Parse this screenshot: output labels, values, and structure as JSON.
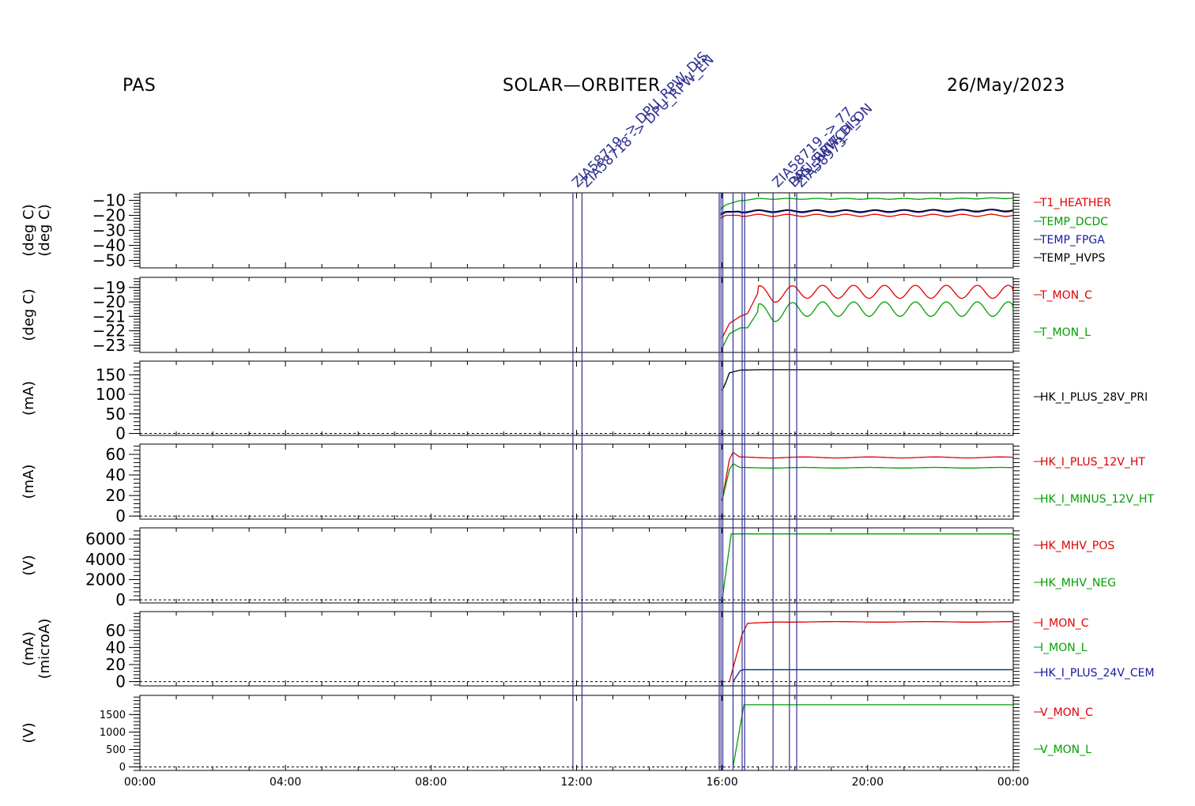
{
  "header": {
    "left": "PAS",
    "center": "SOLAR—ORBITER",
    "right": "26/May/2023"
  },
  "colors": {
    "red": "#e00000",
    "green": "#00a000",
    "blue": "#1a1aa0",
    "black": "#000000",
    "event": "#303090"
  },
  "chart_data": {
    "type": "line",
    "x_axis": {
      "range_hours": [
        0,
        24
      ],
      "tick_labels": [
        "00:00",
        "04:00",
        "08:00",
        "12:00",
        "16:00",
        "20:00",
        "00:00"
      ],
      "tick_hours": [
        0,
        4,
        8,
        12,
        16,
        20,
        24
      ]
    },
    "events": {
      "lines_hours": [
        11.9,
        12.15,
        15.92,
        15.97,
        16.02,
        16.3,
        16.55,
        16.62,
        17.4,
        17.85,
        18.05
      ],
      "labels": [
        {
          "text": "ZIA58719 -> DPU_RPW_DIS",
          "hour": 11.9
        },
        {
          "text": "ZIA58718 -> DPU_RPW_EN",
          "hour": 12.15
        },
        {
          "text": "ZIA58719 -> 77",
          "hour": 17.4
        },
        {
          "text": "DPU_RPW_DIS",
          "hour": 17.85
        },
        {
          "text": "PAS_SWITCH_ON",
          "hour": 17.85
        },
        {
          "text": "ZIA58973",
          "hour": 18.05
        }
      ]
    },
    "panels": [
      {
        "id": "temps",
        "ylabel": "(deg C)",
        "ylabel2": "(deg C)",
        "ylim": [
          -55,
          -5
        ],
        "yticks": [
          -10,
          -20,
          -30,
          -40,
          -50
        ],
        "ytick_labels": [
          "−10",
          "−20",
          "−30",
          "−40",
          "−50"
        ],
        "series": [
          {
            "name": "T1_HEATHER",
            "color": "red",
            "points": [
              [
                15.95,
                -22
              ],
              [
                16.1,
                -20
              ],
              [
                17,
                -20
              ],
              [
                18,
                -20
              ],
              [
                19,
                -20
              ],
              [
                20,
                -20
              ],
              [
                21,
                -20
              ],
              [
                22,
                -20
              ],
              [
                23,
                -20
              ],
              [
                24,
                -20
              ]
            ],
            "osc": [
              0.7,
              0.8
            ]
          },
          {
            "name": "TEMP_DCDC",
            "color": "green",
            "points": [
              [
                15.95,
                -16
              ],
              [
                16.1,
                -13
              ],
              [
                16.5,
                -10
              ],
              [
                17,
                -9
              ],
              [
                18,
                -9
              ],
              [
                20,
                -9
              ],
              [
                22,
                -9
              ],
              [
                24,
                -8.5
              ]
            ],
            "osc": [
              0.3,
              0.8
            ]
          },
          {
            "name": "TEMP_FPGA",
            "color": "blue",
            "points": [
              [
                15.95,
                -20
              ],
              [
                16.1,
                -18
              ],
              [
                17,
                -17.5
              ],
              [
                20,
                -17.5
              ],
              [
                24,
                -17
              ]
            ],
            "osc": [
              0.7,
              0.8
            ]
          },
          {
            "name": "TEMP_HVPS",
            "color": "black",
            "points": [
              [
                15.95,
                -19
              ],
              [
                16.1,
                -17.5
              ],
              [
                17,
                -17
              ],
              [
                20,
                -17
              ],
              [
                24,
                -16.5
              ]
            ],
            "osc": [
              0.6,
              0.8
            ]
          }
        ]
      },
      {
        "id": "tmon",
        "ylabel": "(deg C)",
        "ylabel2": "",
        "ylim": [
          -23.5,
          -18.3
        ],
        "yticks": [
          -19,
          -20,
          -21,
          -22,
          -23
        ],
        "ytick_labels": [
          "−19",
          "−20",
          "−21",
          "−22",
          "−23"
        ],
        "series": [
          {
            "name": "T_MON_C",
            "color": "red",
            "points": [
              [
                16.0,
                -22.5
              ],
              [
                16.2,
                -21.5
              ],
              [
                16.5,
                -21
              ],
              [
                16.7,
                -20.8
              ],
              [
                17.0,
                -19.3
              ],
              [
                17.4,
                -19.6
              ],
              [
                18,
                -19.3
              ],
              [
                24,
                -19.3
              ]
            ],
            "osc_after": 17.0,
            "osc": [
              0.45,
              0.85
            ]
          },
          {
            "name": "T_MON_L",
            "color": "green",
            "points": [
              [
                16.0,
                -23.2
              ],
              [
                16.2,
                -22.2
              ],
              [
                16.5,
                -21.8
              ],
              [
                16.7,
                -21.8
              ],
              [
                17.0,
                -20.6
              ],
              [
                17.4,
                -20.9
              ],
              [
                18,
                -20.5
              ],
              [
                24,
                -20.5
              ]
            ],
            "osc_after": 17.0,
            "osc": [
              0.5,
              0.85
            ]
          }
        ]
      },
      {
        "id": "i28",
        "ylabel": "(mA)",
        "ylabel2": "",
        "ylim": [
          -5,
          185
        ],
        "yticks": [
          150,
          100,
          50,
          0
        ],
        "ytick_labels": [
          "150",
          "100",
          "50",
          "0"
        ],
        "zero_line": true,
        "series": [
          {
            "name": "HK_I_PLUS_28V_PRI",
            "color": "black",
            "points": [
              [
                16.0,
                110
              ],
              [
                16.1,
                130
              ],
              [
                16.2,
                155
              ],
              [
                16.5,
                162
              ],
              [
                17,
                163
              ],
              [
                24,
                163
              ]
            ]
          }
        ]
      },
      {
        "id": "i12",
        "ylabel": "(mA)",
        "ylabel2": "",
        "ylim": [
          -3,
          70
        ],
        "yticks": [
          60,
          40,
          20,
          0
        ],
        "ytick_labels": [
          "60",
          "40",
          "20",
          "0"
        ],
        "zero_line": true,
        "series": [
          {
            "name": "HK_I_PLUS_12V_HT",
            "color": "red",
            "points": [
              [
                16.0,
                15
              ],
              [
                16.2,
                55
              ],
              [
                16.3,
                62
              ],
              [
                16.5,
                57
              ],
              [
                24,
                57
              ]
            ],
            "osc": [
              0.5,
              1.8
            ]
          },
          {
            "name": "HK_I_MINUS_12V_HT",
            "color": "green",
            "points": [
              [
                16.0,
                15
              ],
              [
                16.2,
                45
              ],
              [
                16.3,
                51
              ],
              [
                16.5,
                47
              ],
              [
                24,
                47
              ]
            ],
            "osc": [
              0.3,
              1.8
            ]
          }
        ]
      },
      {
        "id": "mhv",
        "ylabel": "(V)",
        "ylabel2": "",
        "ylim": [
          -300,
          7100
        ],
        "yticks": [
          6000,
          4000,
          2000,
          0
        ],
        "ytick_labels": [
          "6000",
          "4000",
          "2000",
          "0"
        ],
        "zero_line": true,
        "series": [
          {
            "name": "HK_MHV_POS",
            "color": "red",
            "points": []
          },
          {
            "name": "HK_MHV_NEG",
            "color": "green",
            "points": [
              [
                16.0,
                0
              ],
              [
                16.25,
                6500
              ],
              [
                24,
                6500
              ]
            ]
          }
        ]
      },
      {
        "id": "imon",
        "ylabel": "(microA)",
        "ylabel2": "(mA)",
        "ylim": [
          -5,
          82
        ],
        "yticks": [
          60,
          40,
          20,
          0
        ],
        "ytick_labels": [
          "60",
          "40",
          "20",
          "0"
        ],
        "zero_line": true,
        "series": [
          {
            "name": "I_MON_C",
            "color": "red",
            "points": [
              [
                16.2,
                0
              ],
              [
                16.55,
                55
              ],
              [
                16.7,
                68
              ],
              [
                17.5,
                70
              ],
              [
                24,
                70
              ]
            ],
            "osc": [
              0.3,
              2.5
            ]
          },
          {
            "name": "I_MON_L",
            "color": "green",
            "points": [
              [
                16.55,
                14
              ],
              [
                24,
                14
              ]
            ]
          },
          {
            "name": "HK_I_PLUS_24V_CEM",
            "color": "blue",
            "points": [
              [
                16.3,
                0
              ],
              [
                16.5,
                13
              ],
              [
                16.6,
                14
              ],
              [
                24,
                14
              ]
            ]
          }
        ]
      },
      {
        "id": "vmon",
        "ylabel": "(V)",
        "ylabel2": "",
        "ylim": [
          -100,
          2050
        ],
        "yticks": [
          1500,
          1000,
          500,
          0
        ],
        "ytick_labels": [
          "1500",
          "1000",
          "500",
          "0"
        ],
        "zero_line": true,
        "series": [
          {
            "name": "V_MON_C",
            "color": "red",
            "points": []
          },
          {
            "name": "V_MON_L",
            "color": "green",
            "points": [
              [
                16.3,
                0
              ],
              [
                16.6,
                1780
              ],
              [
                24,
                1780
              ]
            ]
          }
        ]
      }
    ]
  }
}
